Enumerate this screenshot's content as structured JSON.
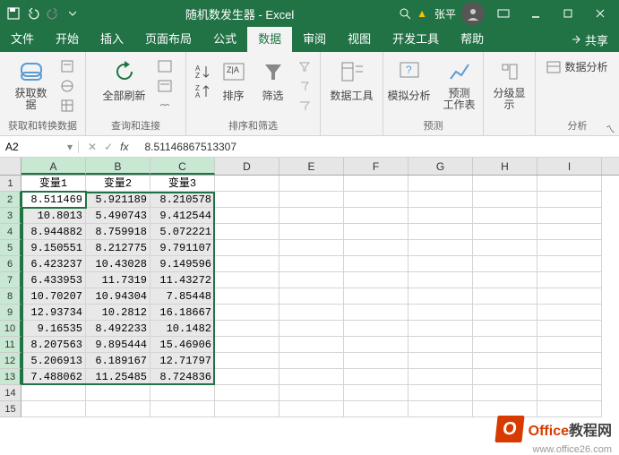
{
  "titlebar": {
    "title": "随机数发生器 - Excel",
    "user": "张平"
  },
  "tabs": {
    "file": "文件",
    "home": "开始",
    "insert": "插入",
    "page_layout": "页面布局",
    "formulas": "公式",
    "data": "数据",
    "review": "审阅",
    "view": "视图",
    "developer": "开发工具",
    "help": "帮助",
    "share": "共享"
  },
  "ribbon": {
    "get_data": "获取数\n据",
    "group_get": "获取和转换数据",
    "refresh_all": "全部刷新",
    "group_query": "查询和连接",
    "sort": "排序",
    "filter": "筛选",
    "group_sortfilter": "排序和筛选",
    "data_tools": "数据工具",
    "whatif": "模拟分析",
    "forecast": "预测\n工作表",
    "group_forecast": "预测",
    "outline": "分级显\n示",
    "data_analysis": "数据分析",
    "group_analysis": "分析"
  },
  "formula_bar": {
    "name": "A2",
    "value": "8.51146867513307"
  },
  "columns": [
    "A",
    "B",
    "C",
    "D",
    "E",
    "F",
    "G",
    "H",
    "I"
  ],
  "headers": {
    "A": "变量1",
    "B": "变量2",
    "C": "变量3"
  },
  "data_rows": [
    {
      "r": 2,
      "A": "8.511469",
      "B": "5.921189",
      "C": "8.210578"
    },
    {
      "r": 3,
      "A": "10.8013",
      "B": "5.490743",
      "C": "9.412544"
    },
    {
      "r": 4,
      "A": "8.944882",
      "B": "8.759918",
      "C": "5.072221"
    },
    {
      "r": 5,
      "A": "9.150551",
      "B": "8.212775",
      "C": "9.791107"
    },
    {
      "r": 6,
      "A": "6.423237",
      "B": "10.43028",
      "C": "9.149596"
    },
    {
      "r": 7,
      "A": "6.433953",
      "B": "11.7319",
      "C": "11.43272"
    },
    {
      "r": 8,
      "A": "10.70207",
      "B": "10.94304",
      "C": "7.85448"
    },
    {
      "r": 9,
      "A": "12.93734",
      "B": "10.2812",
      "C": "16.18667"
    },
    {
      "r": 10,
      "A": "9.16535",
      "B": "8.492233",
      "C": "10.1482"
    },
    {
      "r": 11,
      "A": "8.207563",
      "B": "9.895444",
      "C": "15.46906"
    },
    {
      "r": 12,
      "A": "5.206913",
      "B": "6.189167",
      "C": "12.71797"
    },
    {
      "r": 13,
      "A": "7.488062",
      "B": "11.25485",
      "C": "8.724836"
    }
  ],
  "empty_rows": [
    14,
    15
  ],
  "watermark": {
    "brand": "Office",
    "suffix": "教程网",
    "url": "www.office26.com"
  },
  "chart_data": {
    "type": "table",
    "title": "随机数发生器",
    "columns": [
      "变量1",
      "变量2",
      "变量3"
    ],
    "rows": [
      [
        8.511469,
        5.921189,
        8.210578
      ],
      [
        10.8013,
        5.490743,
        9.412544
      ],
      [
        8.944882,
        8.759918,
        5.072221
      ],
      [
        9.150551,
        8.212775,
        9.791107
      ],
      [
        6.423237,
        10.43028,
        9.149596
      ],
      [
        6.433953,
        11.7319,
        11.43272
      ],
      [
        10.70207,
        10.94304,
        7.85448
      ],
      [
        12.93734,
        10.2812,
        16.18667
      ],
      [
        9.16535,
        8.492233,
        10.1482
      ],
      [
        8.207563,
        9.895444,
        15.46906
      ],
      [
        5.206913,
        6.189167,
        12.71797
      ],
      [
        7.488062,
        11.25485,
        8.724836
      ]
    ]
  }
}
